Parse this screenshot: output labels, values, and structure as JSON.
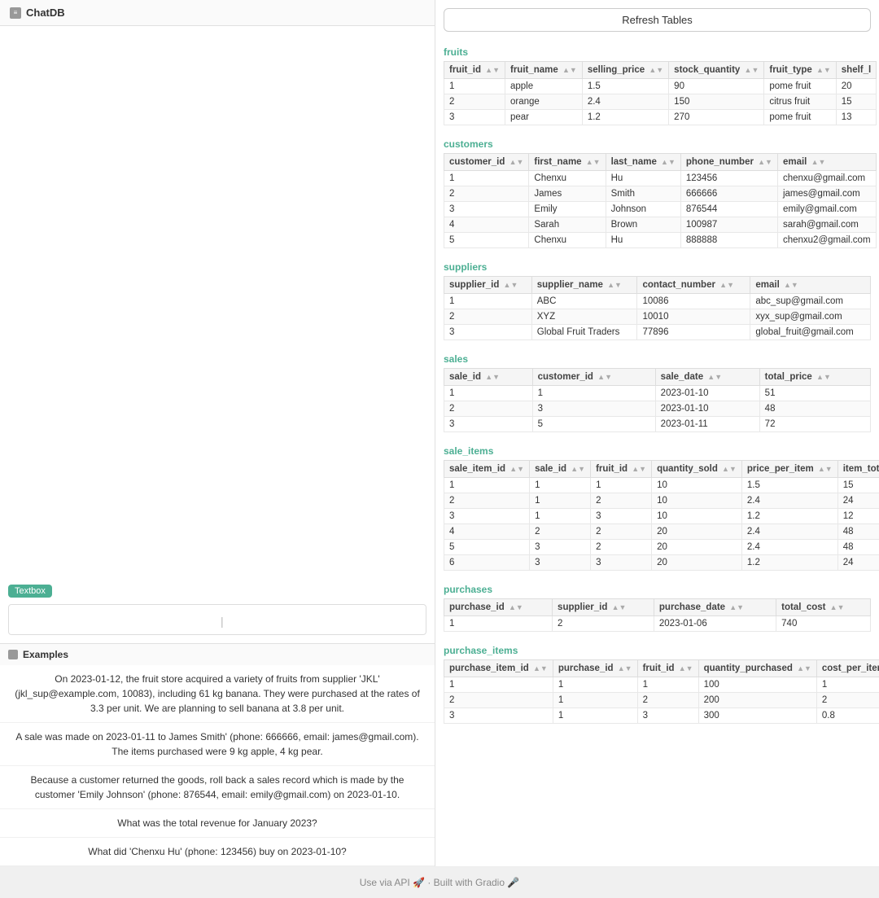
{
  "left_panel": {
    "title": "ChatDB",
    "chat_area": {
      "empty": true
    },
    "textbox_label": "Textbox",
    "textbox_placeholder": "",
    "examples": {
      "title": "Examples",
      "items": [
        "On 2023-01-12, the fruit store acquired a variety of fruits from supplier 'JKL' (jkl_sup@example.com, 10083), including 61 kg banana. They were purchased at the rates of 3.3 per unit. We are planning to sell banana at 3.8 per unit.",
        "A sale was made on 2023-01-11 to James Smith' (phone: 666666, email: james@gmail.com). The items purchased were 9 kg apple, 4 kg pear.",
        "Because a customer returned the goods, roll back a sales record which is made by the customer 'Emily Johnson' (phone: 876544, email: emily@gmail.com) on 2023-01-10.",
        "What was the total revenue for January 2023?",
        "What did 'Chenxu Hu' (phone: 123456) buy on 2023-01-10?"
      ]
    }
  },
  "right_panel": {
    "refresh_btn": "Refresh Tables",
    "tables": {
      "fruits": {
        "title": "fruits",
        "columns": [
          "fruit_id",
          "fruit_name",
          "selling_price",
          "stock_quantity",
          "fruit_type",
          "shelf_l"
        ],
        "rows": [
          [
            "1",
            "apple",
            "1.5",
            "90",
            "pome fruit",
            "20"
          ],
          [
            "2",
            "orange",
            "2.4",
            "150",
            "citrus fruit",
            "15"
          ],
          [
            "3",
            "pear",
            "1.2",
            "270",
            "pome fruit",
            "13"
          ]
        ]
      },
      "customers": {
        "title": "customers",
        "columns": [
          "customer_id",
          "first_name",
          "last_name",
          "phone_number",
          "email"
        ],
        "rows": [
          [
            "1",
            "Chenxu",
            "Hu",
            "123456",
            "chenxu@gmail.com"
          ],
          [
            "2",
            "James",
            "Smith",
            "666666",
            "james@gmail.com"
          ],
          [
            "3",
            "Emily",
            "Johnson",
            "876544",
            "emily@gmail.com"
          ],
          [
            "4",
            "Sarah",
            "Brown",
            "100987",
            "sarah@gmail.com"
          ],
          [
            "5",
            "Chenxu",
            "Hu",
            "888888",
            "chenxu2@gmail.com"
          ]
        ]
      },
      "suppliers": {
        "title": "suppliers",
        "columns": [
          "supplier_id",
          "supplier_name",
          "contact_number",
          "email"
        ],
        "rows": [
          [
            "1",
            "ABC",
            "10086",
            "abc_sup@gmail.com"
          ],
          [
            "2",
            "XYZ",
            "10010",
            "xyx_sup@gmail.com"
          ],
          [
            "3",
            "Global Fruit Traders",
            "77896",
            "global_fruit@gmail.com"
          ]
        ]
      },
      "sales": {
        "title": "sales",
        "columns": [
          "sale_id",
          "customer_id",
          "sale_date",
          "total_price"
        ],
        "rows": [
          [
            "1",
            "1",
            "2023-01-10",
            "51"
          ],
          [
            "2",
            "3",
            "2023-01-10",
            "48"
          ],
          [
            "3",
            "5",
            "2023-01-11",
            "72"
          ]
        ]
      },
      "sale_items": {
        "title": "sale_items",
        "columns": [
          "sale_item_id",
          "sale_id",
          "fruit_id",
          "quantity_sold",
          "price_per_item",
          "item_tot"
        ],
        "rows": [
          [
            "1",
            "1",
            "1",
            "10",
            "1.5",
            "15"
          ],
          [
            "2",
            "1",
            "2",
            "10",
            "2.4",
            "24"
          ],
          [
            "3",
            "1",
            "3",
            "10",
            "1.2",
            "12"
          ],
          [
            "4",
            "2",
            "2",
            "20",
            "2.4",
            "48"
          ],
          [
            "5",
            "3",
            "2",
            "20",
            "2.4",
            "48"
          ],
          [
            "6",
            "3",
            "3",
            "20",
            "1.2",
            "24"
          ]
        ]
      },
      "purchases": {
        "title": "purchases",
        "columns": [
          "purchase_id",
          "supplier_id",
          "purchase_date",
          "total_cost"
        ],
        "rows": [
          [
            "1",
            "2",
            "2023-01-06",
            "740"
          ]
        ]
      },
      "purchase_items": {
        "title": "purchase_items",
        "columns": [
          "purchase_item_id",
          "purchase_id",
          "fruit_id",
          "quantity_purchased",
          "cost_per_item"
        ],
        "rows": [
          [
            "1",
            "1",
            "1",
            "100",
            "1"
          ],
          [
            "2",
            "1",
            "2",
            "200",
            "2"
          ],
          [
            "3",
            "1",
            "3",
            "300",
            "0.8"
          ]
        ]
      }
    }
  },
  "footer": {
    "text": "Use via API 🚀 · Built with Gradio 🎤"
  }
}
